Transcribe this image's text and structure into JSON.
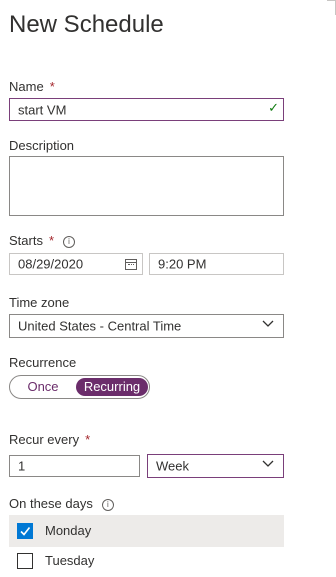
{
  "title": "New Schedule",
  "name": {
    "label": "Name",
    "required": "*",
    "value": "start VM"
  },
  "description": {
    "label": "Description",
    "value": ""
  },
  "starts": {
    "label": "Starts",
    "required": "*",
    "info": "i",
    "date": "08/29/2020",
    "time": "9:20 PM"
  },
  "timezone": {
    "label": "Time zone",
    "value": "United States - Central Time"
  },
  "recurrence": {
    "label": "Recurrence",
    "options": [
      "Once",
      "Recurring"
    ],
    "selected": "Recurring"
  },
  "recur_every": {
    "label": "Recur every",
    "required": "*",
    "value": "1",
    "unit": "Week"
  },
  "days": {
    "label": "On these days",
    "info": "i",
    "items": [
      {
        "label": "Monday",
        "checked": true
      },
      {
        "label": "Tuesday",
        "checked": false
      }
    ]
  },
  "colors": {
    "accent": "#6b2d6b",
    "checkbox": "#0078d4",
    "required": "#a4262c",
    "valid": "#107c10"
  }
}
